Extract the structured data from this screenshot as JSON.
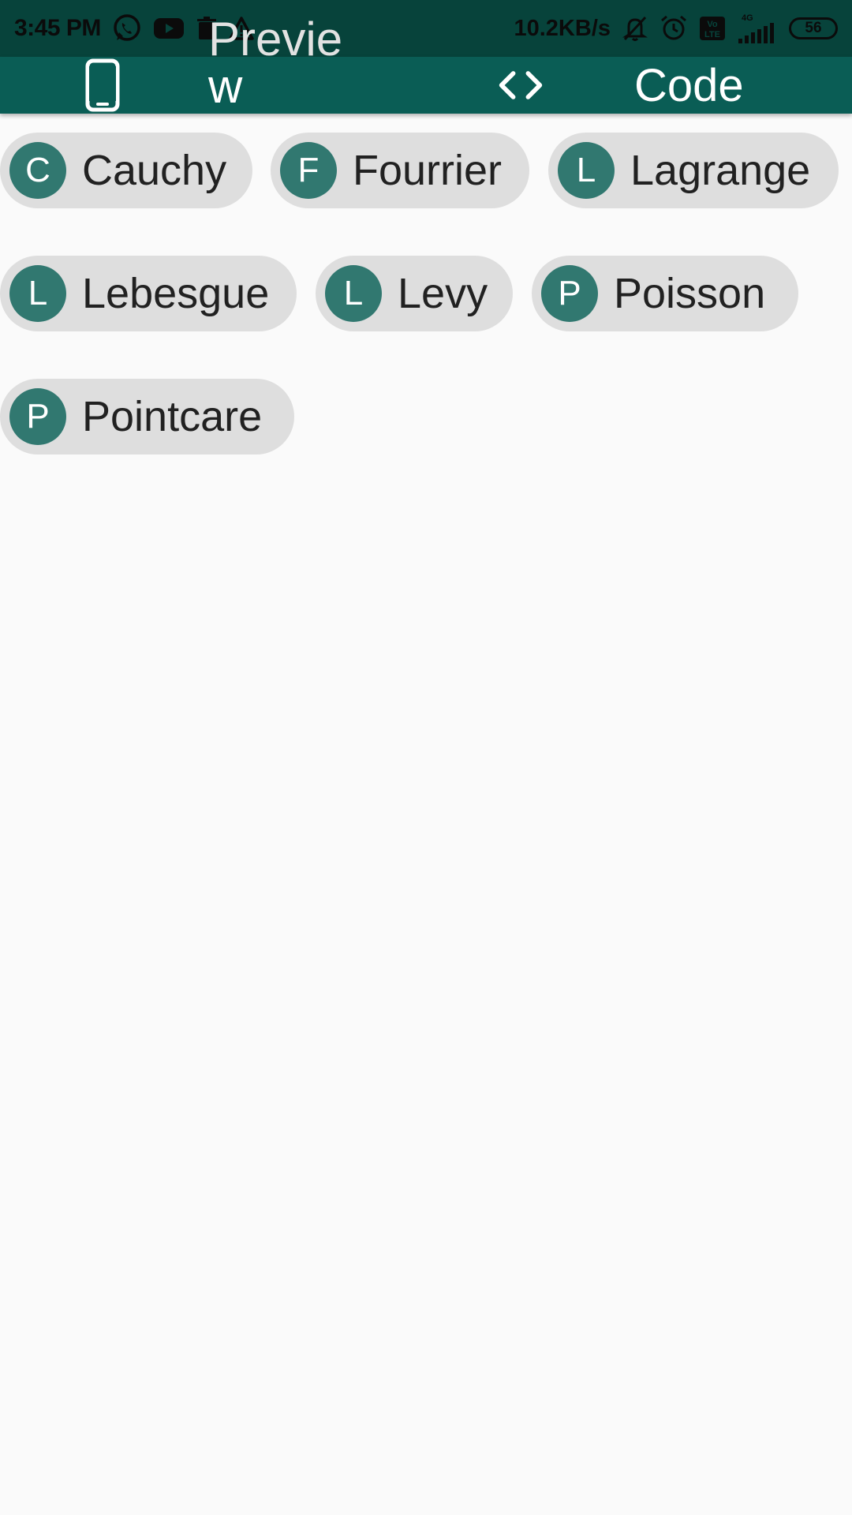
{
  "status_bar": {
    "time": "3:45 PM",
    "net_speed": "10.2KB/s",
    "network_type": "4G",
    "volte_label": "Vo LTE",
    "battery": "56",
    "icons": [
      "whatsapp-icon",
      "youtube-icon",
      "trash-icon",
      "warning-icon",
      "mute-bell-icon",
      "alarm-icon",
      "volte-icon",
      "signal-icon",
      "battery-icon"
    ]
  },
  "toolbar": {
    "background": "#0a5d55",
    "tabs": [
      {
        "label_main": "Previe",
        "label_wrap": "w",
        "icon": "phone-icon"
      },
      {
        "label": "Code",
        "icon": "code-icon"
      }
    ]
  },
  "chips": {
    "avatar_color": "#317870",
    "chip_color": "#dedede",
    "items": [
      {
        "initial": "C",
        "label": "Cauchy"
      },
      {
        "initial": "F",
        "label": "Fourrier"
      },
      {
        "initial": "L",
        "label": "Lagrange"
      },
      {
        "initial": "L",
        "label": "Lebesgue"
      },
      {
        "initial": "L",
        "label": "Levy"
      },
      {
        "initial": "P",
        "label": "Poisson"
      },
      {
        "initial": "P",
        "label": "Pointcare"
      }
    ]
  }
}
